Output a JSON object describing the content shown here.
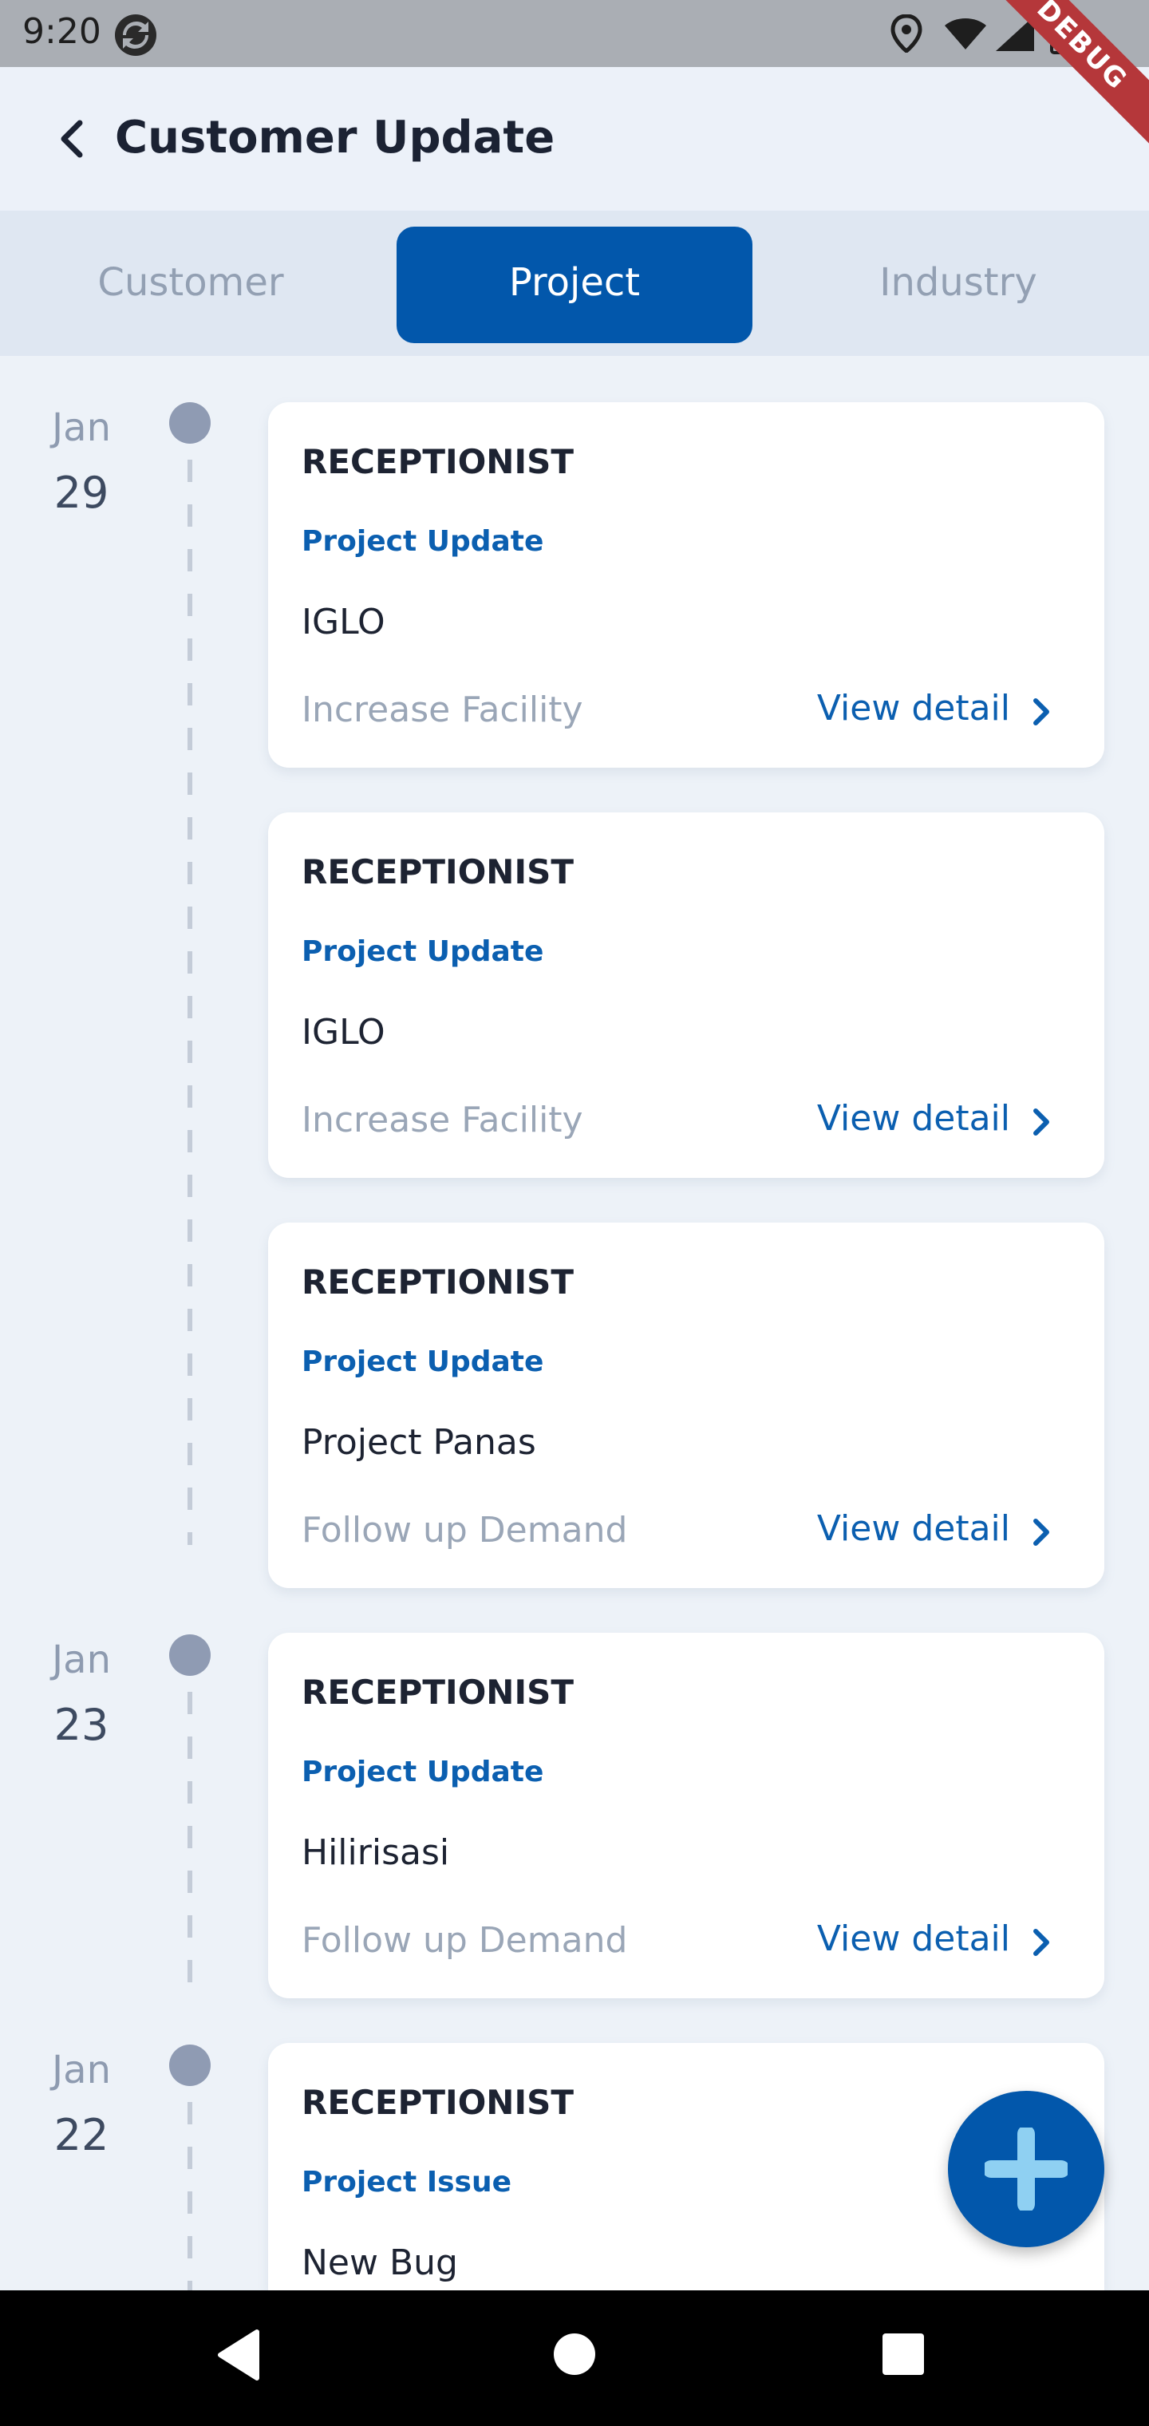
{
  "status_bar": {
    "time": "9:20",
    "debug_label": "DEBUG"
  },
  "header": {
    "title": "Customer Update",
    "back_icon": "chevron-left-icon"
  },
  "tabs": [
    {
      "label": "Customer",
      "active": false
    },
    {
      "label": "Project",
      "active": true
    },
    {
      "label": "Industry",
      "active": false
    }
  ],
  "timeline": {
    "groups": [
      {
        "month": "Jan",
        "day": "29",
        "cards": [
          {
            "role": "RECEPTIONIST",
            "type": "Project Update",
            "name": "IGLO",
            "reason": "Increase Facility",
            "action": "View detail"
          },
          {
            "role": "RECEPTIONIST",
            "type": "Project Update",
            "name": "IGLO",
            "reason": "Increase Facility",
            "action": "View detail"
          },
          {
            "role": "RECEPTIONIST",
            "type": "Project Update",
            "name": "Project Panas",
            "reason": "Follow up Demand",
            "action": "View detail"
          }
        ]
      },
      {
        "month": "Jan",
        "day": "23",
        "cards": [
          {
            "role": "RECEPTIONIST",
            "type": "Project Update",
            "name": "Hilirisasi",
            "reason": "Follow up Demand",
            "action": "View detail"
          }
        ]
      },
      {
        "month": "Jan",
        "day": "22",
        "cards": [
          {
            "role": "RECEPTIONIST",
            "type": "Project Issue",
            "name": "New Bug",
            "reason": "",
            "action": ""
          }
        ]
      }
    ]
  },
  "fab": {
    "icon": "plus-icon"
  },
  "colors": {
    "primary": "#0257ab",
    "accent_text": "#0b5fb0",
    "background": "#edf2f8",
    "muted_text": "#9aa6b7"
  }
}
